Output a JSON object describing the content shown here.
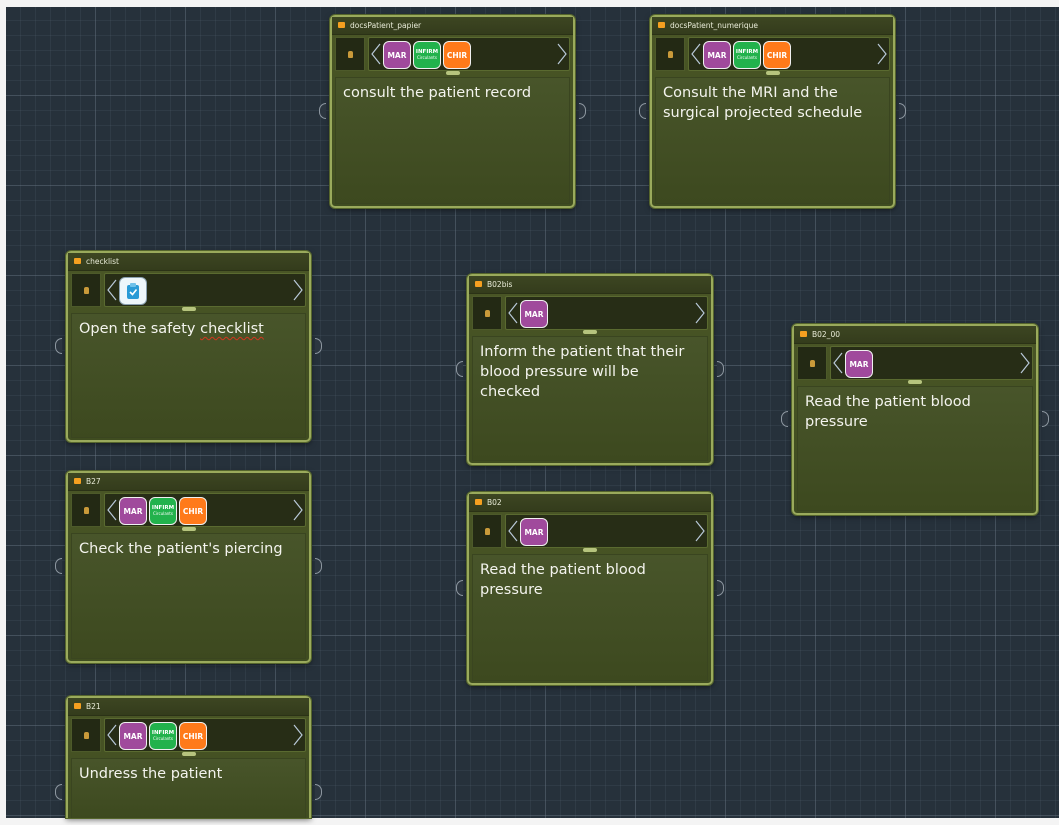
{
  "canvas": {
    "background": "#26313b",
    "node_border": "#9aaa5c",
    "header_marker": "#f5a020"
  },
  "badge_colors": {
    "MAR": "#a04a9c",
    "INF": "#22b24c",
    "CHIR": "#ff7a1a"
  },
  "badge_labels": {
    "mar": "MAR",
    "inf_top": "INFIRM",
    "inf_bottom": "Circulants",
    "chir": "CHIR"
  },
  "nodes": {
    "docs_papier": {
      "title": "docsPatient_papier",
      "text": "consult the patient record",
      "badges": [
        "MAR",
        "INF",
        "CHIR"
      ]
    },
    "docs_numerique": {
      "title": "docsPatient_numerique",
      "text": "Consult the MRI and the surgical projected schedule",
      "badges": [
        "MAR",
        "INF",
        "CHIR"
      ]
    },
    "checklist": {
      "title": "checklist",
      "text_before": "Open the safety ",
      "text_misspelled": "checklist",
      "badges": [
        "checklist-icon"
      ]
    },
    "b02bis": {
      "title": "B02bis",
      "text": "Inform the patient that their blood pressure will be checked",
      "badges": [
        "MAR"
      ]
    },
    "b02_00": {
      "title": "B02_00",
      "text": "Read the patient blood pressure",
      "badges": [
        "MAR"
      ]
    },
    "b27": {
      "title": "B27",
      "text": "Check the patient's piercing",
      "badges": [
        "MAR",
        "INF",
        "CHIR"
      ]
    },
    "b02": {
      "title": "B02",
      "text": "Read the patient blood pressure",
      "badges": [
        "MAR"
      ]
    },
    "b21": {
      "title": "B21",
      "text": "Undress the patient",
      "badges": [
        "MAR",
        "INF",
        "CHIR"
      ]
    }
  }
}
